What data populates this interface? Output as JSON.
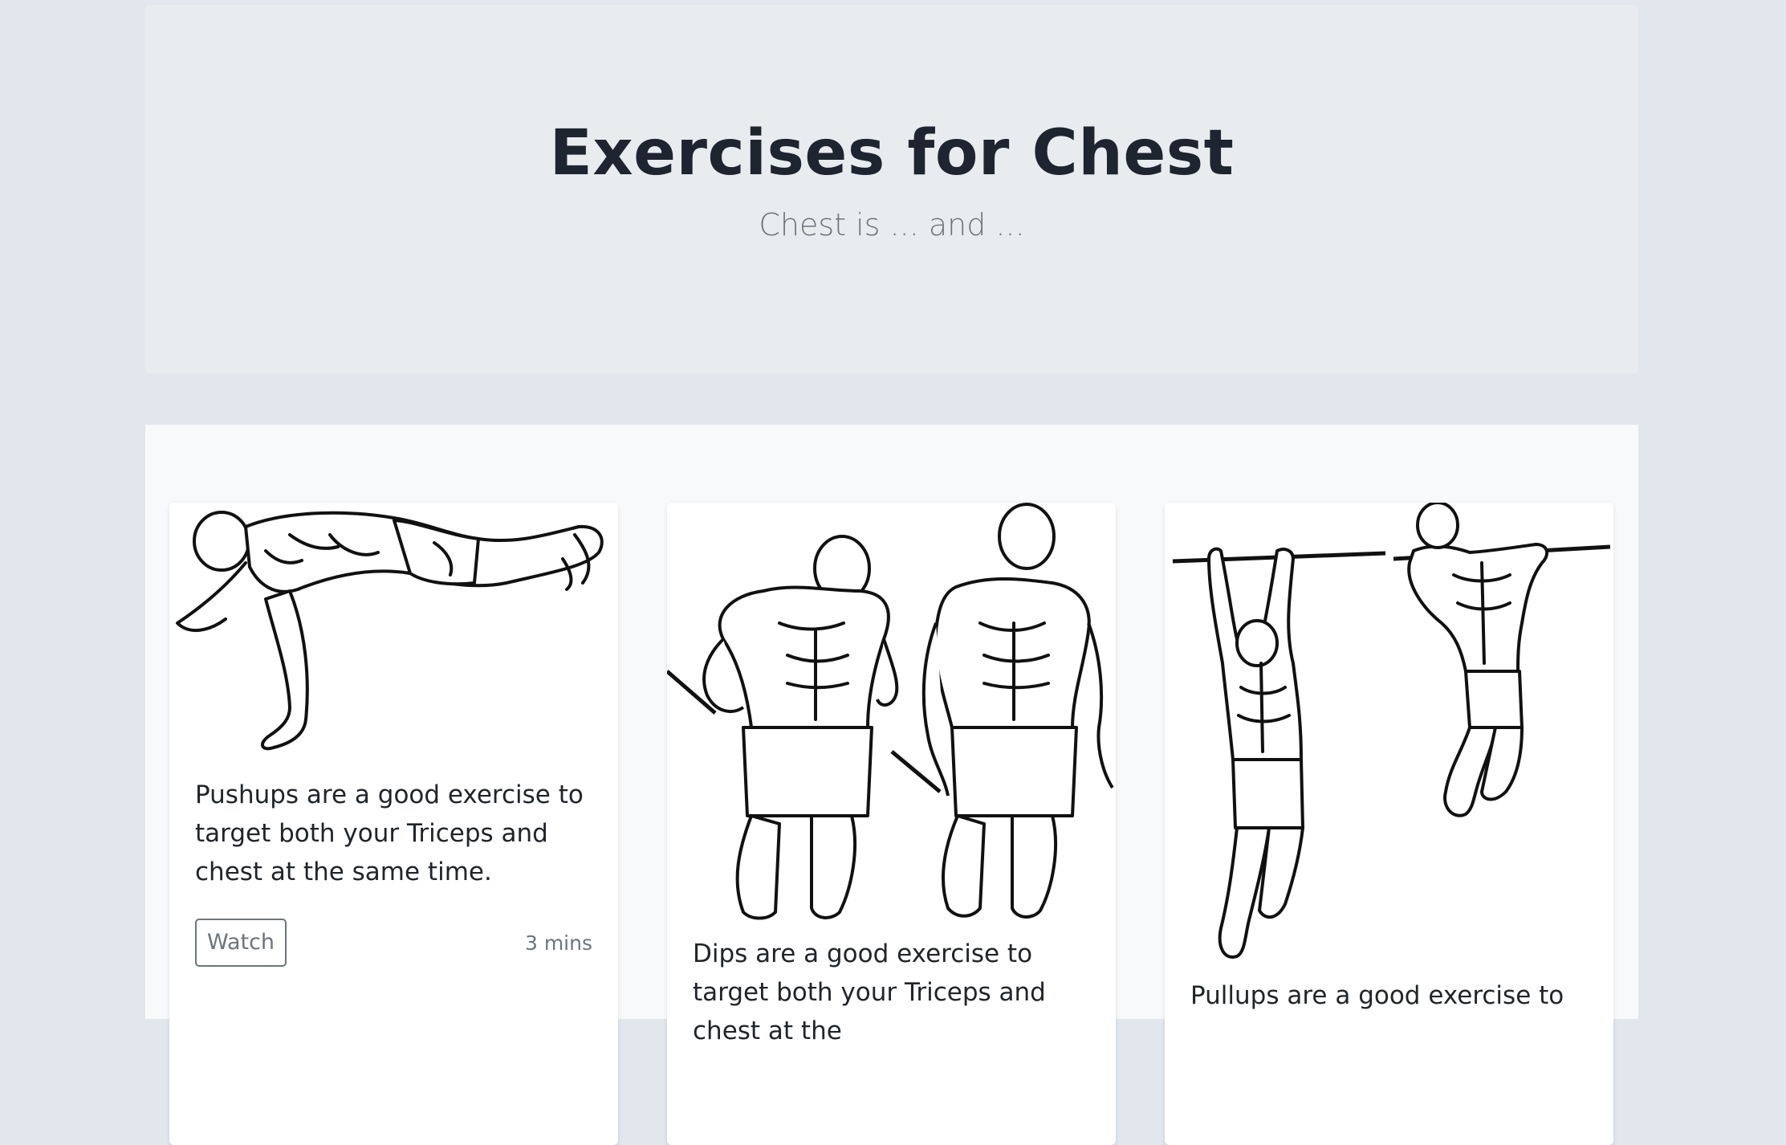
{
  "hero": {
    "title": "Exercises for Chest",
    "subtitle": "Chest is ... and ..."
  },
  "cards": [
    {
      "image_icon": "pushup-illustration",
      "text": "Pushups are a good exercise to target both your Triceps and chest at the same time.",
      "button": "Watch",
      "duration": "3 mins"
    },
    {
      "image_icon": "dips-illustration",
      "text": "Dips are a good exercise to target both your Triceps and chest at the"
    },
    {
      "image_icon": "pullup-illustration",
      "text": "Pullups are a good exercise to"
    }
  ]
}
